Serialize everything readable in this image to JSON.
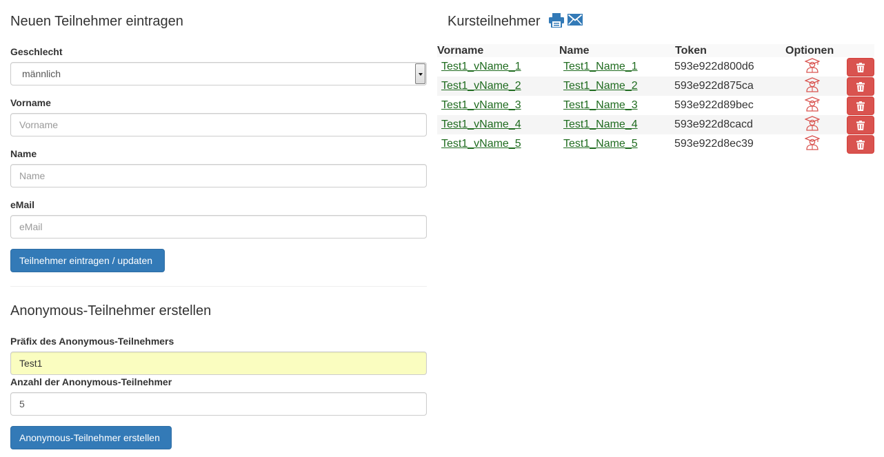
{
  "form": {
    "title": "Neuen Teilnehmer eintragen",
    "gender_label": "Geschlecht",
    "gender_selected": "männlich",
    "firstname_label": "Vorname",
    "firstname_placeholder": "Vorname",
    "lastname_label": "Name",
    "lastname_placeholder": "Name",
    "email_label": "eMail",
    "email_placeholder": "eMail",
    "submit_label": "Teilnehmer eintragen / updaten"
  },
  "anonymous": {
    "title": "Anonymous-Teilnehmer erstellen",
    "prefix_label": "Präfix des Anonymous-Teilnehmers",
    "prefix_value": "Test1",
    "count_label": "Anzahl der Anonymous-Teilnehmer",
    "count_value": "5",
    "submit_label": "Anonymous-Teilnehmer erstellen"
  },
  "participants": {
    "title": "Kursteilnehmer",
    "header_icons": [
      "print-icon",
      "envelope-icon"
    ],
    "columns": [
      "Vorname",
      "Name",
      "Token",
      "Optionen"
    ],
    "rows": [
      {
        "firstname": "Test1_vName_1",
        "lastname": "Test1_Name_1",
        "token": "593e922d800d6"
      },
      {
        "firstname": "Test1_vName_2",
        "lastname": "Test1_Name_2",
        "token": "593e922d875ca"
      },
      {
        "firstname": "Test1_vName_3",
        "lastname": "Test1_Name_3",
        "token": "593e922d89bec"
      },
      {
        "firstname": "Test1_vName_4",
        "lastname": "Test1_Name_4",
        "token": "593e922d8cacd"
      },
      {
        "firstname": "Test1_vName_5",
        "lastname": "Test1_Name_5",
        "token": "593e922d8ec39"
      }
    ],
    "row_icons": [
      "student-icon",
      "trash-icon"
    ]
  },
  "colors": {
    "primary": "#337ab7",
    "danger": "#d9534f",
    "link": "#1f6b1f",
    "student_icon": "#d9534f",
    "highlight_input": "#fafdc0"
  }
}
